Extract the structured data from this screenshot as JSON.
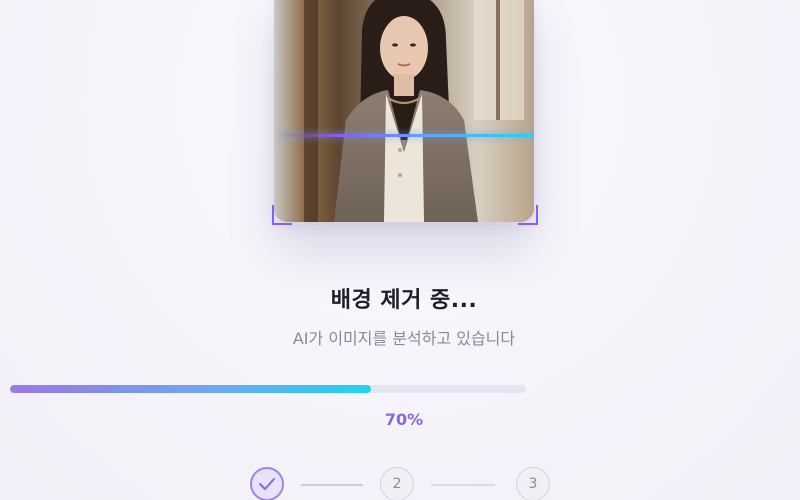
{
  "status": {
    "title": "배경 제거 중...",
    "subtitle": "AI가 이미지를 분석하고 있습니다"
  },
  "progress": {
    "value": 0.7,
    "label": "70%"
  },
  "steps": [
    {
      "number": "1",
      "state": "completed",
      "icon": "check-icon"
    },
    {
      "number": "2",
      "state": "pending"
    },
    {
      "number": "3",
      "state": "pending"
    }
  ],
  "colors": {
    "accent_purple": "#8b5cf6",
    "accent_cyan": "#22d3ee",
    "progress_text": "#8b68d6"
  }
}
